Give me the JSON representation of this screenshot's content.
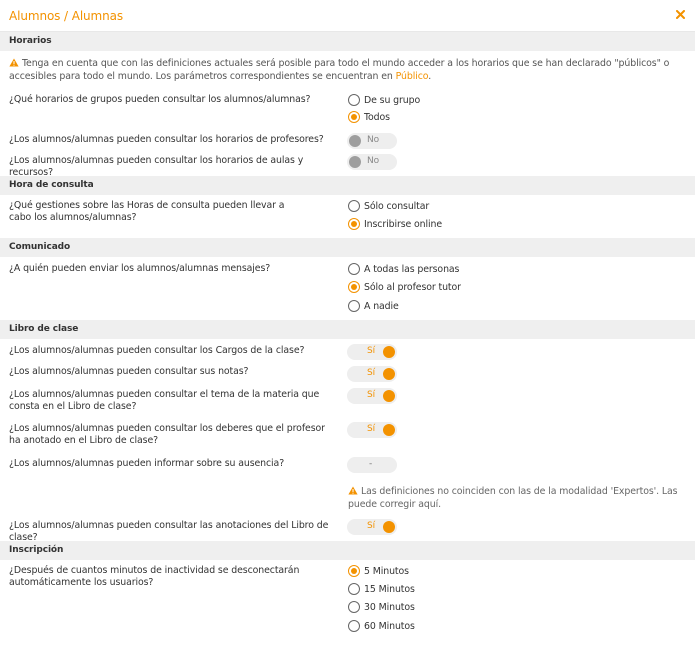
{
  "dialog": {
    "title": "Alumnos / Alumnas"
  },
  "colors": {
    "accent": "#f39200",
    "section_bg": "#efefef"
  },
  "horarios": {
    "heading": "Horarios",
    "notice_prefix": "Tenga en cuenta que con las definiciones actuales será posible para todo el mundo acceder a los horarios que se han declarado \"públicos\" o accesibles para todo el mundo. Los parámetros correspondientes se encuentran en ",
    "notice_link": "Público",
    "notice_suffix": ".",
    "q1": {
      "label": "¿Qué horarios de grupos pueden consultar los alumnos/alumnas?",
      "options": [
        "De su grupo",
        "Todos"
      ],
      "selected": 1
    },
    "q2": {
      "label": "¿Los alumnos/alumnas pueden consultar los horarios de profesores?",
      "value": "No"
    },
    "q3": {
      "label": "¿Los alumnos/alumnas pueden consultar los horarios de aulas y recursos?",
      "value": "No"
    }
  },
  "hora_consulta": {
    "heading": "Hora de consulta",
    "q1": {
      "label": "¿Qué gestiones sobre las Horas de consulta pueden llevar a cabo los alumnos/alumnas?",
      "options": [
        "Sólo consultar",
        "Inscribirse online"
      ],
      "selected": 1
    }
  },
  "comunicado": {
    "heading": "Comunicado",
    "q1": {
      "label": "¿A quién pueden enviar los alumnos/alumnas mensajes?",
      "options": [
        "A todas las personas",
        "Sólo al profesor tutor",
        "A nadie"
      ],
      "selected": 1
    }
  },
  "libro_clase": {
    "heading": "Libro de clase",
    "q1": {
      "label": "¿Los alumnos/alumnas pueden consultar los Cargos de la clase?",
      "value": "Sí"
    },
    "q2": {
      "label": "¿Los alumnos/alumnas pueden consultar sus notas?",
      "value": "Sí"
    },
    "q3": {
      "label": "¿Los alumnos/alumnas pueden consultar el tema de la materia que consta en el Libro de clase?",
      "value": "Sí"
    },
    "q4": {
      "label": "¿Los alumnos/alumnas pueden consultar los deberes que el profesor ha anotado en el Libro de clase?",
      "value": "Sí"
    },
    "q5": {
      "label": "¿Los alumnos/alumnas pueden informar sobre su ausencia?",
      "value": "-"
    },
    "warning_prefix": "Las definiciones no coinciden con las de la modalidad 'Expertos'. Las puede ",
    "warning_link": "corregir aquí",
    "warning_suffix": ".",
    "q6": {
      "label": "¿Los alumnos/alumnas pueden consultar las anotaciones del Libro de clase?",
      "value": "Sí"
    }
  },
  "inscripcion": {
    "heading": "Inscripción",
    "q1": {
      "label": "¿Después de cuantos minutos de inactividad se desconectarán automáticamente los usuarios?",
      "options": [
        "5 Minutos",
        "15 Minutos",
        "30 Minutos",
        "60 Minutos"
      ],
      "selected": 0
    }
  }
}
